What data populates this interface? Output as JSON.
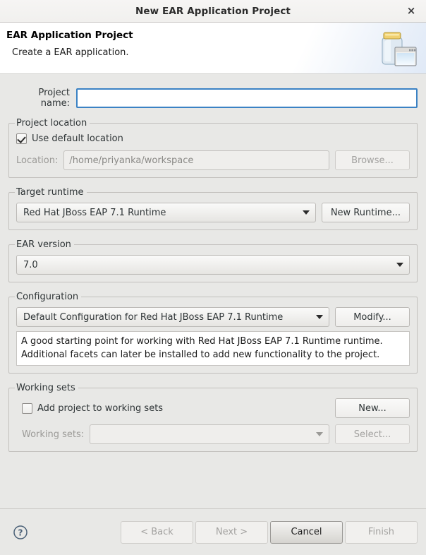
{
  "window": {
    "title": "New EAR Application Project",
    "close_label": "×"
  },
  "header": {
    "title": "EAR Application Project",
    "subtitle": "Create a EAR application.",
    "icon": "ear-jar-icon"
  },
  "form": {
    "project_name": {
      "label": "Project name:",
      "value": "",
      "placeholder": ""
    },
    "project_location": {
      "group_label": "Project location",
      "use_default_label": "Use default location",
      "use_default_checked": true,
      "location_label": "Location:",
      "location_value": "/home/priyanka/workspace",
      "browse_label": "Browse..."
    },
    "target_runtime": {
      "group_label": "Target runtime",
      "selected": "Red Hat JBoss EAP 7.1 Runtime",
      "new_runtime_label": "New Runtime..."
    },
    "ear_version": {
      "group_label": "EAR version",
      "selected": "7.0"
    },
    "configuration": {
      "group_label": "Configuration",
      "selected": "Default Configuration for Red Hat JBoss EAP 7.1 Runtime",
      "modify_label": "Modify...",
      "description_line1": "A good starting point for working with Red Hat JBoss EAP 7.1 Runtime runtime.",
      "description_line2": "Additional facets can later be installed to add new functionality to the project."
    },
    "working_sets": {
      "group_label": "Working sets",
      "add_label": "Add project to working sets",
      "add_checked": false,
      "new_label": "New...",
      "sets_label": "Working sets:",
      "sets_value": "",
      "select_label": "Select..."
    }
  },
  "footer": {
    "help": "help-icon",
    "back_label": "< Back",
    "next_label": "Next >",
    "cancel_label": "Cancel",
    "finish_label": "Finish"
  },
  "colors": {
    "accent": "#3b82c4",
    "dialog_bg": "#e8e8e6",
    "panel_white": "#ffffff",
    "border": "#c2c0bd",
    "disabled_text": "#8a8986"
  }
}
